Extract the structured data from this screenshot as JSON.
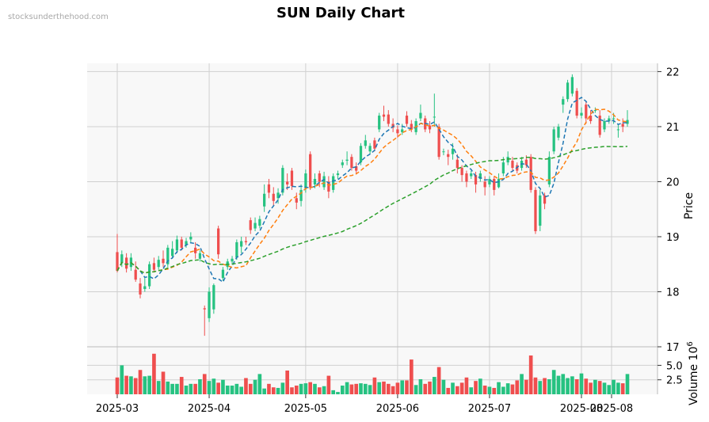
{
  "watermark": "stocksunderthehood.com",
  "title": "SUN Daily Chart",
  "chart_data": {
    "type": "candlestick",
    "title": "SUN Daily Chart",
    "ylabel": "Price",
    "volume_label": "Volume",
    "volume_exponent_base": "10",
    "volume_exponent": "6",
    "price_ylim": [
      17,
      22.15
    ],
    "volume_ylim": [
      0,
      8.2
    ],
    "price_ticks": [
      "17",
      "18",
      "19",
      "20",
      "21",
      "22"
    ],
    "volume_ticks": [
      "2.5",
      "5.0"
    ],
    "x_tick_labels": [
      "2025-03",
      "2025-04",
      "2025-05",
      "2025-06",
      "2025-07",
      "2025-08",
      "2025-08"
    ],
    "colors": {
      "up": "#26c281",
      "down": "#ef4e4e",
      "ma_short": "#1f77b4",
      "ma_mid": "#ff7f0e",
      "ma_long": "#2ca02c",
      "panel_bg": "#f8f8f8",
      "grid": "#d0d0d0"
    },
    "grid": true,
    "candles": [
      [
        18.72,
        18.38,
        19.05,
        18.35,
        2.9
      ],
      [
        18.52,
        18.68,
        18.75,
        18.45,
        5.0
      ],
      [
        18.62,
        18.42,
        18.7,
        18.35,
        3.2
      ],
      [
        18.45,
        18.62,
        18.7,
        18.38,
        3.1
      ],
      [
        18.4,
        18.22,
        18.55,
        18.18,
        2.8
      ],
      [
        18.15,
        17.95,
        18.25,
        17.88,
        4.2
      ],
      [
        18.05,
        18.1,
        18.25,
        18.0,
        3.1
      ],
      [
        18.1,
        18.5,
        18.55,
        18.05,
        3.2
      ],
      [
        18.52,
        18.4,
        18.62,
        18.35,
        7.0
      ],
      [
        18.45,
        18.58,
        18.65,
        18.4,
        2.3
      ],
      [
        18.6,
        18.52,
        18.75,
        18.45,
        3.9
      ],
      [
        18.5,
        18.8,
        18.85,
        18.45,
        2.2
      ],
      [
        18.65,
        18.78,
        18.92,
        18.6,
        1.8
      ],
      [
        18.75,
        18.95,
        19.02,
        18.7,
        1.8
      ],
      [
        18.95,
        18.8,
        19.0,
        18.75,
        3.0
      ],
      [
        18.85,
        18.92,
        18.98,
        18.8,
        1.5
      ],
      [
        18.95,
        19.0,
        19.08,
        18.9,
        1.8
      ],
      [
        18.8,
        18.7,
        18.9,
        18.6,
        1.8
      ],
      [
        18.6,
        18.7,
        18.75,
        18.55,
        2.6
      ],
      [
        17.7,
        17.68,
        17.75,
        17.2,
        3.5
      ],
      [
        17.52,
        18.0,
        18.08,
        17.45,
        2.3
      ],
      [
        17.68,
        18.12,
        18.15,
        17.6,
        2.7
      ],
      [
        19.15,
        18.68,
        19.2,
        18.6,
        2.0
      ],
      [
        18.25,
        18.4,
        18.45,
        18.2,
        2.5
      ],
      [
        18.45,
        18.55,
        18.6,
        18.4,
        1.5
      ],
      [
        18.55,
        18.6,
        18.65,
        18.5,
        1.5
      ],
      [
        18.62,
        18.9,
        18.95,
        18.58,
        1.8
      ],
      [
        18.82,
        18.92,
        19.0,
        18.7,
        1.3
      ],
      [
        18.92,
        18.9,
        19.0,
        18.85,
        2.8
      ],
      [
        19.3,
        19.12,
        19.35,
        19.05,
        1.8
      ],
      [
        19.15,
        19.25,
        19.35,
        19.1,
        2.5
      ],
      [
        19.2,
        19.32,
        19.38,
        19.15,
        3.5
      ],
      [
        19.55,
        19.78,
        19.95,
        19.45,
        1.0
      ],
      [
        19.95,
        19.8,
        20.05,
        19.7,
        1.8
      ],
      [
        19.78,
        19.65,
        19.9,
        19.55,
        1.2
      ],
      [
        19.7,
        19.8,
        19.88,
        19.6,
        1.1
      ],
      [
        19.8,
        20.25,
        20.3,
        19.75,
        2.0
      ],
      [
        20.0,
        19.95,
        20.15,
        19.85,
        4.1
      ],
      [
        20.2,
        19.92,
        20.25,
        19.85,
        1.2
      ],
      [
        19.7,
        19.62,
        19.8,
        19.5,
        1.5
      ],
      [
        19.65,
        19.85,
        19.95,
        19.55,
        1.8
      ],
      [
        19.88,
        20.15,
        20.22,
        19.8,
        1.9
      ],
      [
        20.5,
        19.9,
        20.55,
        19.85,
        2.1
      ],
      [
        19.95,
        20.05,
        20.15,
        19.88,
        1.8
      ],
      [
        20.15,
        20.0,
        20.2,
        19.9,
        1.2
      ],
      [
        19.9,
        20.1,
        20.18,
        19.85,
        1.4
      ],
      [
        20.0,
        19.82,
        20.1,
        19.7,
        3.2
      ],
      [
        19.85,
        20.1,
        20.15,
        19.8,
        0.7
      ],
      [
        20.12,
        20.15,
        20.2,
        20.05,
        0.4
      ],
      [
        20.3,
        20.35,
        20.4,
        20.25,
        1.5
      ],
      [
        20.38,
        20.4,
        20.55,
        20.3,
        2.1
      ],
      [
        20.45,
        20.25,
        20.5,
        20.2,
        1.7
      ],
      [
        20.28,
        20.2,
        20.35,
        20.15,
        1.8
      ],
      [
        20.35,
        20.65,
        20.7,
        20.3,
        1.9
      ],
      [
        20.65,
        20.75,
        20.85,
        20.6,
        1.8
      ],
      [
        20.55,
        20.65,
        20.7,
        20.5,
        1.6
      ],
      [
        20.75,
        20.6,
        20.8,
        20.55,
        2.9
      ],
      [
        20.95,
        21.2,
        21.25,
        20.9,
        2.1
      ],
      [
        21.22,
        21.18,
        21.38,
        21.1,
        2.2
      ],
      [
        21.22,
        21.05,
        21.3,
        21.0,
        1.8
      ],
      [
        21.05,
        20.98,
        21.15,
        20.9,
        1.4
      ],
      [
        20.95,
        20.88,
        21.02,
        20.8,
        2.0
      ],
      [
        20.9,
        20.95,
        21.05,
        20.85,
        2.4
      ],
      [
        21.2,
        21.05,
        21.28,
        21.0,
        2.4
      ],
      [
        21.05,
        20.95,
        21.12,
        20.9,
        6.0
      ],
      [
        20.9,
        21.1,
        21.15,
        20.85,
        1.6
      ],
      [
        21.15,
        21.25,
        21.4,
        21.1,
        2.6
      ],
      [
        21.15,
        20.95,
        21.2,
        20.9,
        1.8
      ],
      [
        21.02,
        20.95,
        21.1,
        20.88,
        2.2
      ],
      [
        21.18,
        21.18,
        21.6,
        21.0,
        3.0
      ],
      [
        21.0,
        20.45,
        21.05,
        20.4,
        4.7
      ],
      [
        20.55,
        20.55,
        20.6,
        20.48,
        2.5
      ],
      [
        20.5,
        20.45,
        20.58,
        20.3,
        1.1
      ],
      [
        20.5,
        20.6,
        20.7,
        20.4,
        2.0
      ],
      [
        20.4,
        20.25,
        20.5,
        20.15,
        1.4
      ],
      [
        20.25,
        20.12,
        20.3,
        20.0,
        2.0
      ],
      [
        20.15,
        20.0,
        20.2,
        19.9,
        2.9
      ],
      [
        20.1,
        20.15,
        20.2,
        20.05,
        1.2
      ],
      [
        20.12,
        19.95,
        20.18,
        19.8,
        2.3
      ],
      [
        20.05,
        20.15,
        20.2,
        20.0,
        2.7
      ],
      [
        20.0,
        19.9,
        20.1,
        19.75,
        1.5
      ],
      [
        19.95,
        20.05,
        20.1,
        19.9,
        1.3
      ],
      [
        20.05,
        19.85,
        20.1,
        19.75,
        1.1
      ],
      [
        19.9,
        20.05,
        20.15,
        19.88,
        2.1
      ],
      [
        20.15,
        20.35,
        20.45,
        20.1,
        1.3
      ],
      [
        20.35,
        20.45,
        20.55,
        20.3,
        1.9
      ],
      [
        20.38,
        20.25,
        20.45,
        20.2,
        1.7
      ],
      [
        20.3,
        20.2,
        20.35,
        20.15,
        2.4
      ],
      [
        20.25,
        20.38,
        20.45,
        20.2,
        3.5
      ],
      [
        20.4,
        20.3,
        20.48,
        20.25,
        2.5
      ],
      [
        20.45,
        19.85,
        20.5,
        19.8,
        6.7
      ],
      [
        19.85,
        19.1,
        19.9,
        19.05,
        2.9
      ],
      [
        19.2,
        19.75,
        19.85,
        19.1,
        2.3
      ],
      [
        19.75,
        19.6,
        19.8,
        19.5,
        2.8
      ],
      [
        19.95,
        20.45,
        20.55,
        19.9,
        2.6
      ],
      [
        20.55,
        20.95,
        21.0,
        20.5,
        4.2
      ],
      [
        20.8,
        21.0,
        21.05,
        20.75,
        3.2
      ],
      [
        21.4,
        21.5,
        21.55,
        21.25,
        3.5
      ],
      [
        21.5,
        21.8,
        21.85,
        21.45,
        2.8
      ],
      [
        21.6,
        21.9,
        21.95,
        21.55,
        3.1
      ],
      [
        21.65,
        21.2,
        21.7,
        21.15,
        2.6
      ],
      [
        21.2,
        21.25,
        21.35,
        21.15,
        3.6
      ],
      [
        21.4,
        21.15,
        21.45,
        21.05,
        2.7
      ],
      [
        21.2,
        21.1,
        21.3,
        21.05,
        2.0
      ],
      [
        21.3,
        21.3,
        21.35,
        21.25,
        2.5
      ],
      [
        21.2,
        20.85,
        21.3,
        20.8,
        2.3
      ],
      [
        20.95,
        21.1,
        21.15,
        20.9,
        2.0
      ],
      [
        21.1,
        21.15,
        21.2,
        21.05,
        1.6
      ],
      [
        21.15,
        21.15,
        21.25,
        21.05,
        2.5
      ],
      [
        20.95,
        20.95,
        21.05,
        20.8,
        2.0
      ],
      [
        21.05,
        21.0,
        21.15,
        20.9,
        1.9
      ],
      [
        21.05,
        21.12,
        21.3,
        21.0,
        3.5
      ]
    ]
  }
}
